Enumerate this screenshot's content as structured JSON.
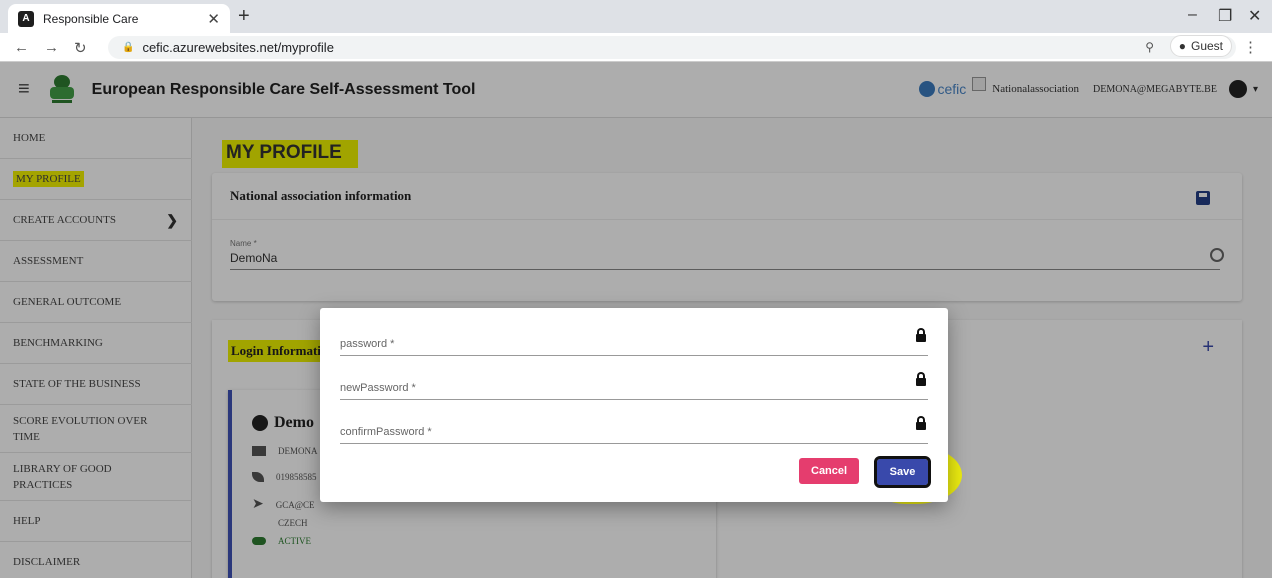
{
  "browser": {
    "tab_title": "Responsible Care",
    "tab_icon": "angular-icon",
    "new_tab": "+",
    "url_host": "cefic.azurewebsites.net",
    "url_path": "/myprofile",
    "profile_label": "Guest"
  },
  "header": {
    "title": "European Responsible Care Self-Assessment Tool",
    "cefic_label": "cefic",
    "association": "Nationalassociation",
    "user": "DEMONA@MEGABYTE.BE"
  },
  "sidebar": {
    "items": [
      {
        "label": "HOME"
      },
      {
        "label": "MY PROFILE"
      },
      {
        "label": "CREATE ACCOUNTS"
      },
      {
        "label": "ASSESSMENT"
      },
      {
        "label": "GENERAL OUTCOME"
      },
      {
        "label": "BENCHMARKING"
      },
      {
        "label": "STATE OF THE BUSINESS"
      },
      {
        "label": "SCORE EVOLUTION OVER TIME"
      },
      {
        "label": "LIBRARY OF GOOD PRACTICES"
      },
      {
        "label": "HELP"
      },
      {
        "label": "DISCLAIMER"
      }
    ]
  },
  "main": {
    "page_title": "MY PROFILE",
    "nat_card": {
      "title": "National association information",
      "name_label": "Name *",
      "name_value": "DemoNa"
    },
    "login_card": {
      "title": "Login Informati",
      "user_name": "Demo",
      "email": "DEMONA",
      "phone": "019858585",
      "contact": "GCA@CE",
      "country": "CZECH",
      "status": "ACTIVE"
    }
  },
  "dialog": {
    "password_label": "password *",
    "new_password_label": "newPassword *",
    "confirm_password_label": "confirmPassword *",
    "cancel_label": "Cancel",
    "save_label": "Save"
  },
  "colors": {
    "highlight": "#eef200",
    "primary": "#3949ab",
    "cancel": "#e53d6e",
    "active": "#2e7d32"
  }
}
